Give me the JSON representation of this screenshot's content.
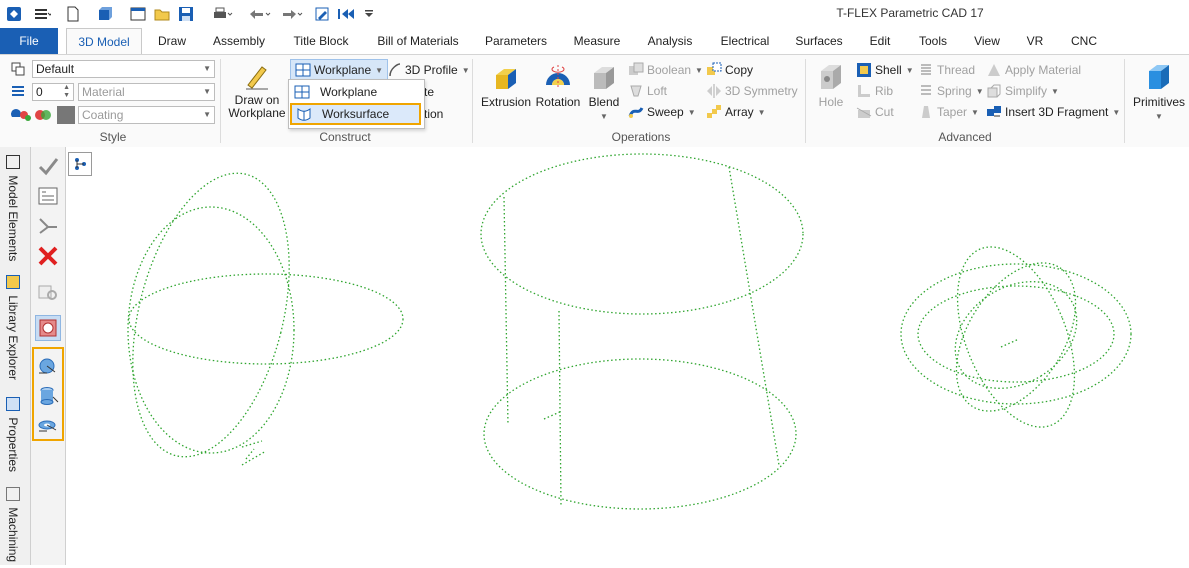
{
  "window": {
    "title": "T-FLEX Parametric CAD 17"
  },
  "quick_access": [
    {
      "name": "app-menu-icon"
    },
    {
      "name": "menu-lines-icon"
    },
    {
      "name": "new-file-icon"
    },
    {
      "name": "open-model-icon"
    },
    {
      "name": "window-icon"
    },
    {
      "name": "open-folder-icon"
    },
    {
      "name": "save-icon"
    },
    {
      "name": "print-icon"
    },
    {
      "name": "undo-icon"
    },
    {
      "name": "redo-icon"
    },
    {
      "name": "edit-icon"
    },
    {
      "name": "back-icon"
    },
    {
      "name": "customize-icon"
    }
  ],
  "tabs": [
    "File",
    "3D Model",
    "Draw",
    "Assembly",
    "Title Block",
    "Bill of Materials",
    "Parameters",
    "Measure",
    "Analysis",
    "Electrical",
    "Surfaces",
    "Edit",
    "Tools",
    "View",
    "VR",
    "CNC"
  ],
  "active_tab": "3D Model",
  "style": {
    "label": "Style",
    "style_value": "Default",
    "layer_value": "0",
    "material_value": "Material",
    "coating_value": "Coating"
  },
  "construct": {
    "label": "Construct",
    "draw_on_workplane_line1": "Draw on",
    "draw_on_workplane_line2": "Workplane",
    "workplane_label": "Workplane",
    "profile_label": "3D Profile",
    "hidden_item1": "te",
    "hidden_item2": "tion"
  },
  "workplane_menu": {
    "items": [
      "Workplane",
      "Worksurface"
    ],
    "selected": "Worksurface"
  },
  "operations": {
    "label": "Operations",
    "extrusion": "Extrusion",
    "rotation": "Rotation",
    "blend": "Blend",
    "boolean": "Boolean",
    "loft": "Loft",
    "sweep": "Sweep",
    "copy": "Copy",
    "symmetry": "3D Symmetry",
    "array": "Array"
  },
  "advanced": {
    "label": "Advanced",
    "hole": "Hole",
    "shell": "Shell",
    "rib": "Rib",
    "cut": "Cut",
    "thread": "Thread",
    "spring": "Spring",
    "taper": "Taper",
    "apply_material": "Apply Material",
    "simplify": "Simplify",
    "insert_fragment": "Insert 3D Fragment"
  },
  "primitives": {
    "label": "Primitives"
  },
  "side_tabs": [
    "Model Elements",
    "Library Explorer",
    "Properties",
    "Machining"
  ],
  "colors": {
    "accent": "#1a5fb4",
    "highlight": "#f0a500",
    "wire": "#2fa52f"
  }
}
